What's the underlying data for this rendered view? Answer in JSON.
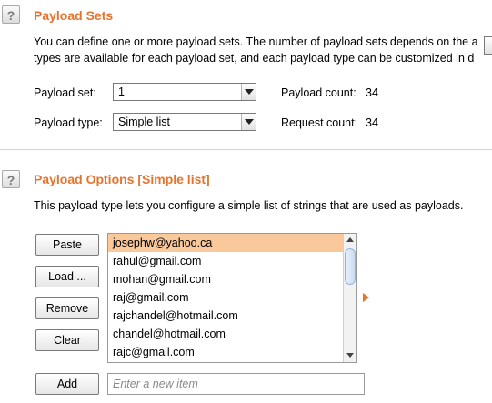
{
  "payload_sets": {
    "help_glyph": "?",
    "title": "Payload Sets",
    "description_line1": "You can define one or more payload sets. The number of payload sets depends on the a",
    "description_line2": "types are available for each payload set, and each payload type can be customized in d",
    "set_label": "Payload set:",
    "set_value": "1",
    "type_label": "Payload type:",
    "type_value": "Simple list",
    "payload_count_label": "Payload count:",
    "payload_count_value": "34",
    "request_count_label": "Request count:",
    "request_count_value": "34"
  },
  "payload_options": {
    "help_glyph": "?",
    "title": "Payload Options [Simple list]",
    "description": "This payload type lets you configure a simple list of strings that are used as payloads.",
    "buttons": {
      "paste": "Paste",
      "load": "Load ...",
      "remove": "Remove",
      "clear": "Clear",
      "add": "Add"
    },
    "list_items": [
      "josephw@yahoo.ca",
      "rahul@gmail.com",
      "mohan@gmail.com",
      "raj@gmail.com",
      "rajchandel@hotmail.com",
      "chandel@hotmail.com",
      "rajc@gmail.com"
    ],
    "selected_index": 0,
    "new_item_placeholder": "Enter a new item"
  },
  "colors": {
    "accent": "#e8732d",
    "selection": "#f9c89b"
  }
}
